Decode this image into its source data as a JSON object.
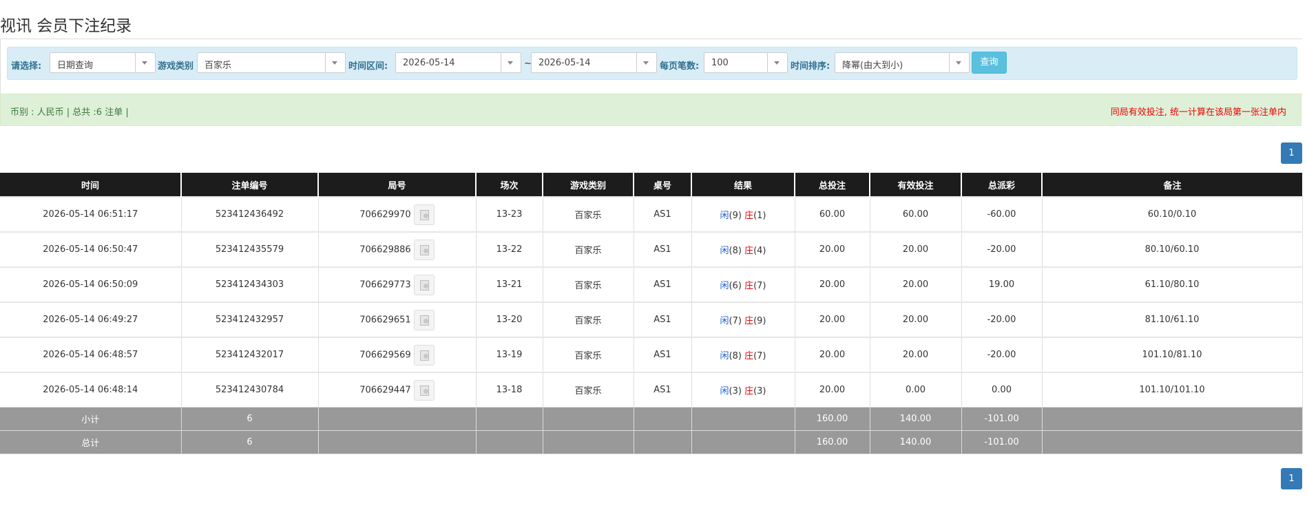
{
  "page": {
    "title": "视讯 会员下注纪录"
  },
  "filters": {
    "select_label": "请选择:",
    "date_query": "日期查询",
    "game_type_label": "游戏类别",
    "game_type": "百家乐",
    "time_range_label": "时间区间:",
    "date_from": "2026-05-14",
    "tilde": "~",
    "date_to": "2026-05-14",
    "per_page_label": "每页笔数:",
    "per_page": "100",
    "sort_label": "时间排序:",
    "sort": "降幂(由大到小)",
    "query_button": "查询"
  },
  "info": {
    "summary": "币别 : 人民币 | 总共 :6 注单 |",
    "notice": "同局有效投注, 统一计算在该局第一张注单内"
  },
  "pagination": {
    "top_page": "1",
    "bottom_page": "1"
  },
  "table": {
    "headers": [
      "时间",
      "注单编号",
      "局号",
      "场次",
      "游戏类别",
      "桌号",
      "结果",
      "总投注",
      "有效投注",
      "总派彩",
      "备注"
    ],
    "rows": [
      {
        "time": "2026-05-14 06:51:17",
        "bet_id": "523412436492",
        "round": "706629970",
        "shoe": "13-23",
        "game": "百家乐",
        "table": "AS1",
        "player_label": "闲",
        "player_score": "(9)",
        "banker_label": "庄",
        "banker_score": "(1)",
        "total_bet": "60.00",
        "valid_bet": "60.00",
        "payout": "-60.00",
        "note": "60.10/0.10",
        "payout_color": "red"
      },
      {
        "time": "2026-05-14 06:50:47",
        "bet_id": "523412435579",
        "round": "706629886",
        "shoe": "13-22",
        "game": "百家乐",
        "table": "AS1",
        "player_label": "闲",
        "player_score": "(8)",
        "banker_label": "庄",
        "banker_score": "(4)",
        "total_bet": "20.00",
        "valid_bet": "20.00",
        "payout": "-20.00",
        "note": "80.10/60.10",
        "payout_color": "red"
      },
      {
        "time": "2026-05-14 06:50:09",
        "bet_id": "523412434303",
        "round": "706629773",
        "shoe": "13-21",
        "game": "百家乐",
        "table": "AS1",
        "player_label": "闲",
        "player_score": "(6)",
        "banker_label": "庄",
        "banker_score": "(7)",
        "total_bet": "20.00",
        "valid_bet": "20.00",
        "payout": "19.00",
        "note": "61.10/80.10",
        "payout_color": "normal"
      },
      {
        "time": "2026-05-14 06:49:27",
        "bet_id": "523412432957",
        "round": "706629651",
        "shoe": "13-20",
        "game": "百家乐",
        "table": "AS1",
        "player_label": "闲",
        "player_score": "(7)",
        "banker_label": "庄",
        "banker_score": "(9)",
        "total_bet": "20.00",
        "valid_bet": "20.00",
        "payout": "-20.00",
        "note": "81.10/61.10",
        "payout_color": "red"
      },
      {
        "time": "2026-05-14 06:48:57",
        "bet_id": "523412432017",
        "round": "706629569",
        "shoe": "13-19",
        "game": "百家乐",
        "table": "AS1",
        "player_label": "闲",
        "player_score": "(8)",
        "banker_label": "庄",
        "banker_score": "(7)",
        "total_bet": "20.00",
        "valid_bet": "20.00",
        "payout": "-20.00",
        "note": "101.10/81.10",
        "payout_color": "red"
      },
      {
        "time": "2026-05-14 06:48:14",
        "bet_id": "523412430784",
        "round": "706629447",
        "shoe": "13-18",
        "game": "百家乐",
        "table": "AS1",
        "player_label": "闲",
        "player_score": "(3)",
        "banker_label": "庄",
        "banker_score": "(3)",
        "total_bet": "20.00",
        "valid_bet": "0.00",
        "payout": "0.00",
        "note": "101.10/101.10",
        "payout_color": "normal"
      }
    ],
    "subtotal": {
      "label": "小计",
      "count": "6",
      "total_bet": "160.00",
      "valid_bet": "140.00",
      "payout": "-101.00"
    },
    "grandtotal": {
      "label": "总计",
      "count": "6",
      "total_bet": "160.00",
      "valid_bet": "140.00",
      "payout": "-101.00"
    }
  },
  "colors": {
    "header_bg": "#1c1c1c",
    "filter_bg": "#d9edf7",
    "info_bg": "#dff0d8",
    "summary_bg": "#999999",
    "link_blue": "#1a73e8",
    "negative_red": "#ff0000",
    "page_button": "#337ab7",
    "query_button": "#5bc0de"
  },
  "icons": {
    "video_replay": "video-replay-icon",
    "dropdown": "chevron-down-icon"
  }
}
